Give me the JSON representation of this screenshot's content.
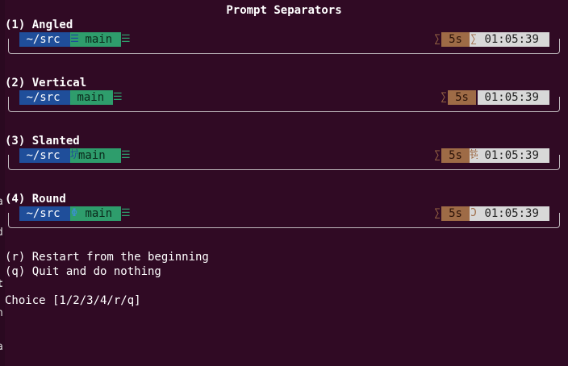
{
  "window": {
    "title": "Prompt Separators"
  },
  "edge_glyphs": [
    "a",
    "d",
    "t",
    "h",
    "a"
  ],
  "prompts": [
    {
      "heading": "(1) Angled",
      "dir": "~/src",
      "git": "main",
      "dir_git_sep": "☰",
      "git_end_sep": "☰",
      "dur_start_sep": "∑",
      "duration": "5s",
      "dur_clk_sep": "∑",
      "time": "01:05:39"
    },
    {
      "heading": "(2) Vertical",
      "dir": "~/src",
      "git": "main",
      "dir_git_sep": "",
      "git_end_sep": "☰",
      "dur_start_sep": "∑",
      "duration": "5s",
      "dur_clk_sep": "",
      "time": "01:05:39"
    },
    {
      "heading": "(3) Slanted",
      "dir": "~/src",
      "git": "main",
      "dir_git_sep": "坑",
      "git_end_sep": "☰",
      "dur_start_sep": "∑",
      "duration": "5s",
      "dur_clk_sep": "钩",
      "time": "01:05:39"
    },
    {
      "heading": "(4) Round",
      "dir": "~/src",
      "git": "main",
      "dir_git_sep": "Φ",
      "git_end_sep": "☰",
      "dur_start_sep": "∑",
      "duration": "5s",
      "dur_clk_sep": "Ɔ",
      "time": "01:05:39"
    }
  ],
  "options": [
    "(r) Restart from the beginning",
    "(q) Quit and do nothing"
  ],
  "choice_prompt": "Choice [1/2/3/4/r/q]",
  "colors": {
    "background": "#300a24",
    "dir_segment": "#1f4e9a",
    "git_segment": "#2e9d6c",
    "duration_segment": "#9e6b46",
    "clock_segment": "#d8d8d8"
  }
}
